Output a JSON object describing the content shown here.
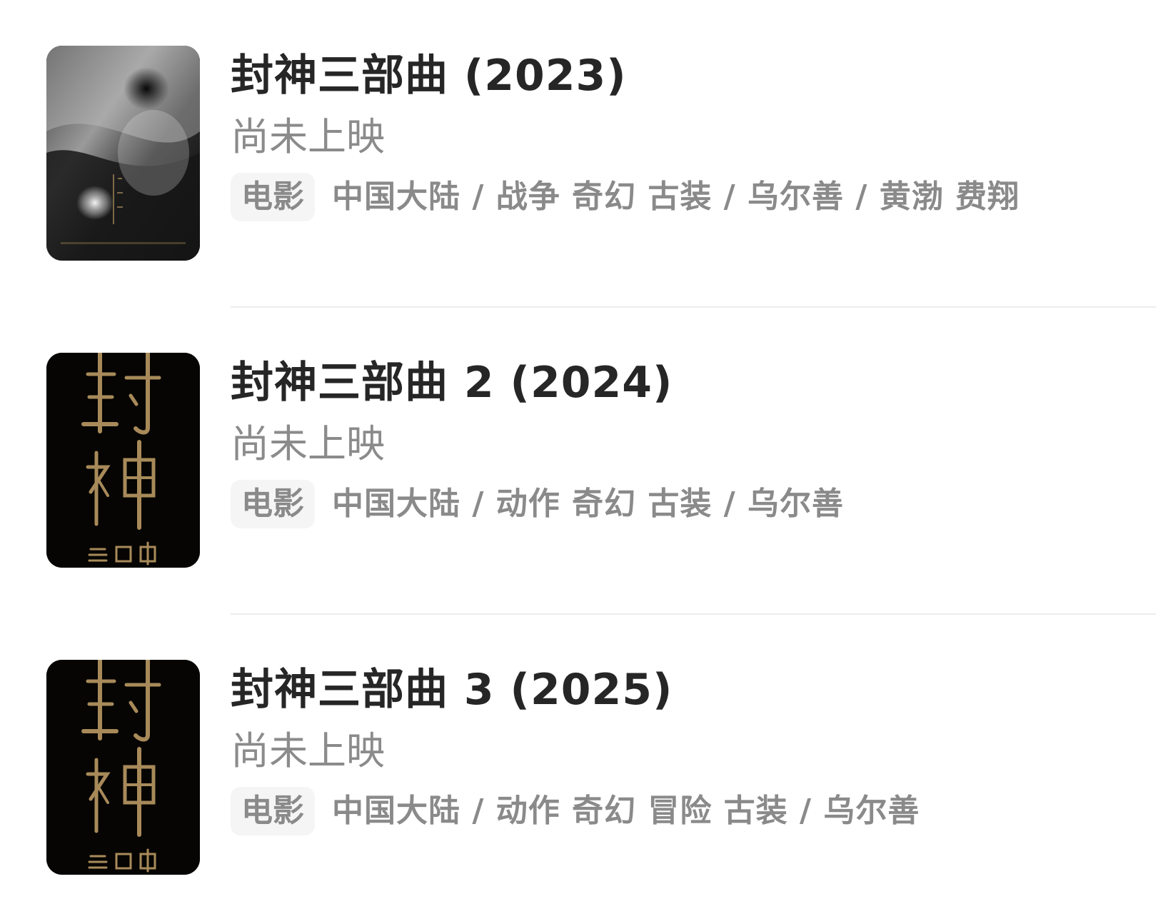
{
  "items": [
    {
      "title": "封神三部曲 (2023)",
      "status": "尚未上映",
      "tag": "电影",
      "meta": "中国大陆 / 战争 奇幻 古装 / 乌尔善 / 黄渤 费翔",
      "poster": {
        "icon": "yin-yang-poster-icon",
        "accent": "#d9d9d9"
      }
    },
    {
      "title": "封神三部曲 2 (2024)",
      "status": "尚未上映",
      "tag": "电影",
      "meta": "中国大陆 / 动作 奇幻 古装 / 乌尔善",
      "poster": {
        "icon": "calligraphy-poster-icon",
        "accent": "#a88a5a"
      }
    },
    {
      "title": "封神三部曲 3 (2025)",
      "status": "尚未上映",
      "tag": "电影",
      "meta": "中国大陆 / 动作 奇幻 冒险 古装 / 乌尔善",
      "poster": {
        "icon": "calligraphy-poster-icon",
        "accent": "#a88a5a"
      }
    }
  ],
  "colors": {
    "title": "#262626",
    "secondary": "#8a8a8a",
    "tag_bg": "#f5f5f5",
    "divider": "#ececec"
  }
}
